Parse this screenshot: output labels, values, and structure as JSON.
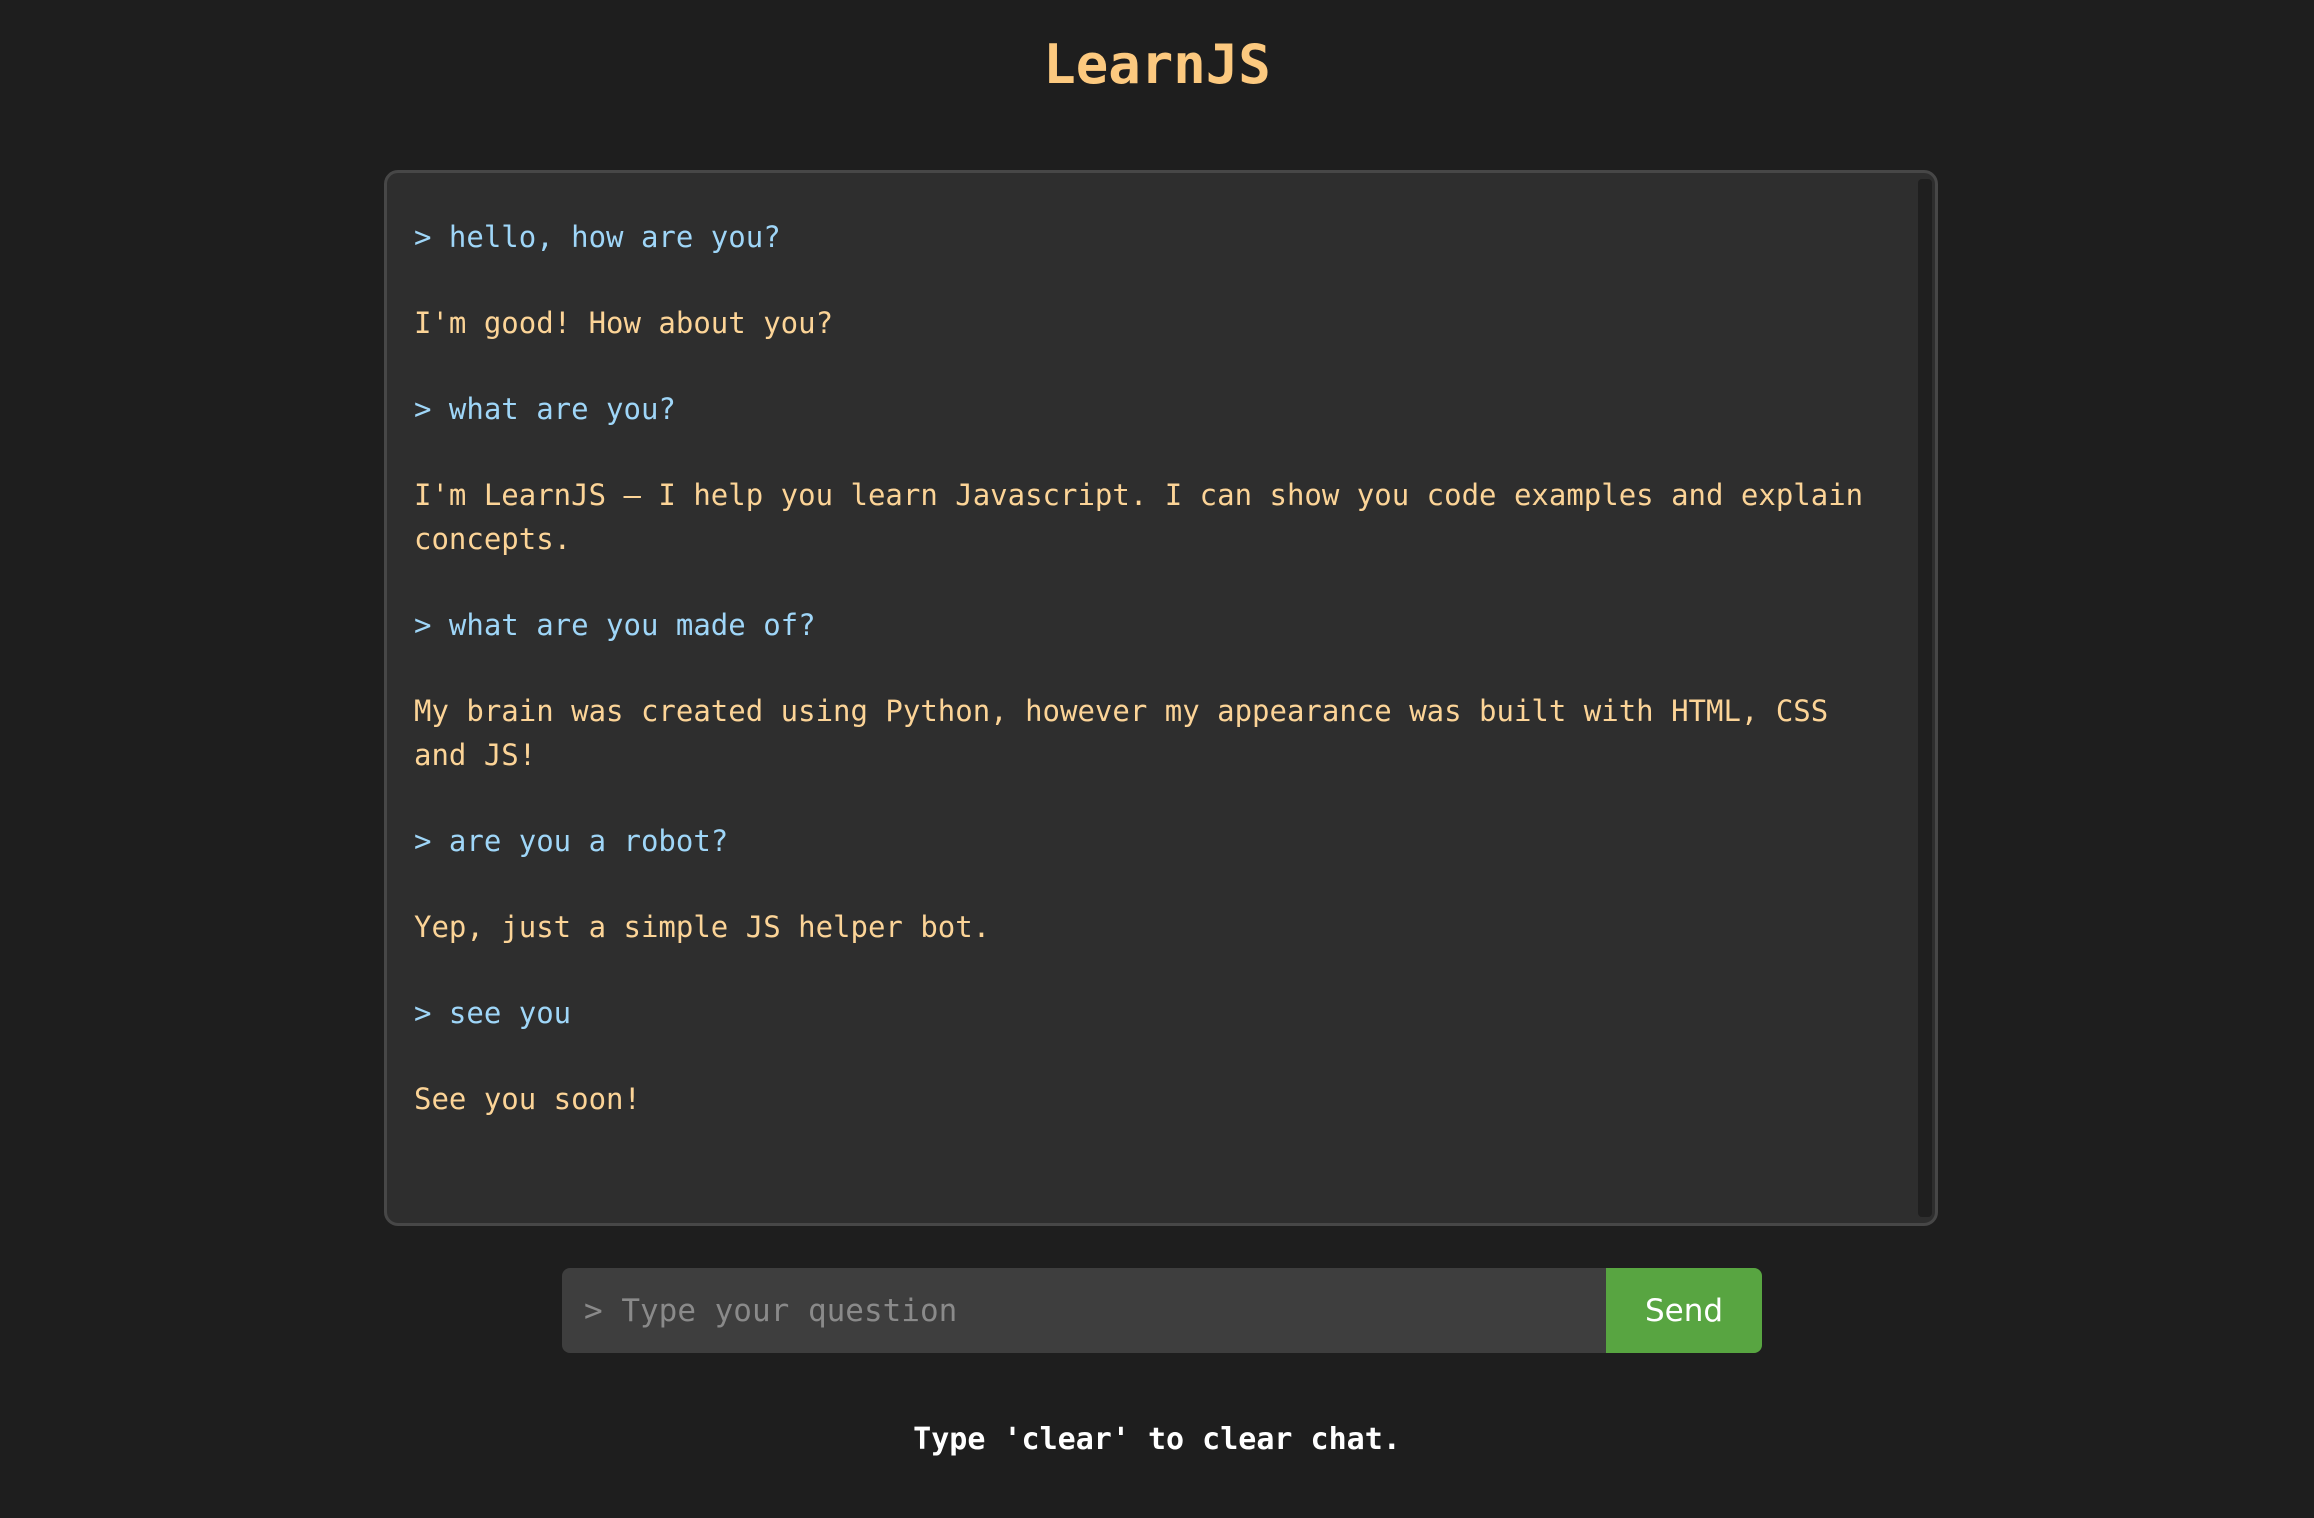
{
  "app": {
    "title": "LearnJS"
  },
  "chat": {
    "messages": [
      {
        "role": "user",
        "text": "> hello, how are you?"
      },
      {
        "role": "bot",
        "text": "I'm good! How about you?"
      },
      {
        "role": "user",
        "text": "> what are you?"
      },
      {
        "role": "bot",
        "text": "I'm LearnJS – I help you learn Javascript. I can show you code examples and explain concepts."
      },
      {
        "role": "user",
        "text": "> what are you made of?"
      },
      {
        "role": "bot",
        "text": "My brain was created using Python, however my appearance was built with HTML, CSS and JS!"
      },
      {
        "role": "user",
        "text": "> are you a robot?"
      },
      {
        "role": "bot",
        "text": "Yep, just a simple JS helper bot."
      },
      {
        "role": "user",
        "text": "> see you"
      },
      {
        "role": "bot",
        "text": "See you soon!"
      }
    ]
  },
  "input": {
    "placeholder": "> Type your question",
    "value": "",
    "send_label": "Send"
  },
  "footer": {
    "hint": "Type 'clear' to clear chat."
  },
  "colors": {
    "background": "#1e1e1e",
    "title": "#fcc97f",
    "user_text": "#9fd6f8",
    "bot_text": "#fcd497",
    "send_button": "#58a541"
  }
}
